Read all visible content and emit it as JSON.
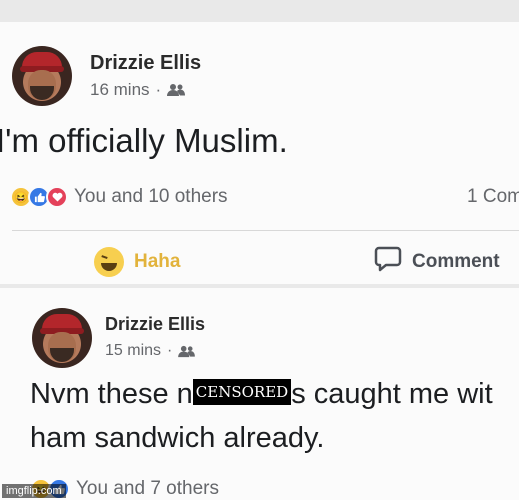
{
  "post1": {
    "author": "Drizzie Ellis",
    "time": "16 mins",
    "separator": "·",
    "text": "I'm officially Muslim.",
    "reactions_text": "You and 10 others",
    "comments_text": "1 Com",
    "haha_label": "Haha",
    "comment_label": "Comment"
  },
  "post2": {
    "author": "Drizzie Ellis",
    "time": "15 mins",
    "separator": "·",
    "text_before": "Nvm these n",
    "censor": "CENSORED",
    "text_after": "s caught me wit",
    "text_line2": "ham sandwich already.",
    "reactions_text": "You and 7 others"
  },
  "watermark": "imgflip.com",
  "icons": {
    "friends": "friends-icon",
    "haha": "haha-icon",
    "like": "like-icon",
    "love": "love-icon",
    "comment": "comment-icon"
  }
}
